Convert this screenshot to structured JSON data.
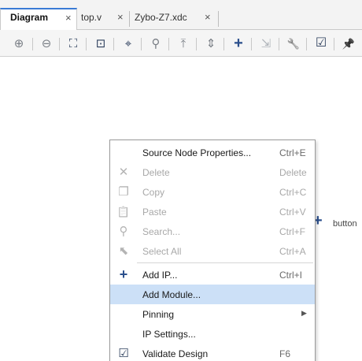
{
  "tabs": [
    {
      "label": "Diagram",
      "active": true
    },
    {
      "label": "top.v",
      "active": false
    },
    {
      "label": "Zybo-Z7.xdc",
      "active": false
    }
  ],
  "tab_close_glyph": "×",
  "toolbar": {
    "buttons": [
      {
        "name": "zoom-in-icon",
        "glyph": "⊕"
      },
      {
        "name": "zoom-out-icon",
        "glyph": "⊖"
      },
      {
        "name": "zoom-fit-icon",
        "glyph": "⛶"
      },
      {
        "name": "zoom-area-icon",
        "glyph": "⊡"
      },
      {
        "name": "auto-fit-selection-icon",
        "glyph": "⌖"
      },
      {
        "name": "search-icon",
        "glyph": "⚲"
      },
      {
        "name": "collapse-all-icon",
        "glyph": "⤒"
      },
      {
        "name": "expand-all-icon",
        "glyph": "⇕"
      },
      {
        "name": "add-ip-icon",
        "glyph": "+"
      },
      {
        "name": "make-connection-icon",
        "glyph": "⇲"
      },
      {
        "name": "wrench-icon",
        "glyph": "🔧"
      },
      {
        "name": "validate-design-icon",
        "glyph": "☑"
      },
      {
        "name": "pin-icon",
        "glyph": "📌"
      }
    ]
  },
  "canvas": {
    "partial_label": "button"
  },
  "context_menu": {
    "items": [
      {
        "label": "Source Node Properties...",
        "shortcut": "Ctrl+E",
        "icon": "",
        "disabled": false
      },
      {
        "label": "Delete",
        "shortcut": "Delete",
        "icon": "✕",
        "disabled": true
      },
      {
        "label": "Copy",
        "shortcut": "Ctrl+C",
        "icon": "❐",
        "disabled": true
      },
      {
        "label": "Paste",
        "shortcut": "Ctrl+V",
        "icon": "📋",
        "disabled": true
      },
      {
        "label": "Search...",
        "shortcut": "Ctrl+F",
        "icon": "⚲",
        "disabled": true
      },
      {
        "label": "Select All",
        "shortcut": "Ctrl+A",
        "icon": "⬉",
        "disabled": true
      },
      {
        "label": "Add IP...",
        "shortcut": "Ctrl+I",
        "icon": "+",
        "disabled": false
      },
      {
        "label": "Add Module...",
        "shortcut": "",
        "icon": "",
        "disabled": false,
        "highlighted": true
      },
      {
        "label": "Pinning",
        "shortcut": "",
        "icon": "",
        "disabled": false,
        "submenu": true
      },
      {
        "label": "IP Settings...",
        "shortcut": "",
        "icon": "",
        "disabled": false
      },
      {
        "label": "Validate Design",
        "shortcut": "F6",
        "icon": "☑",
        "disabled": false
      }
    ],
    "submenu_arrow": "▶"
  },
  "colors": {
    "accent_blue": "#2b4f8c",
    "highlight": "#cce0f7",
    "tab_active_border": "#3a7bd5"
  }
}
